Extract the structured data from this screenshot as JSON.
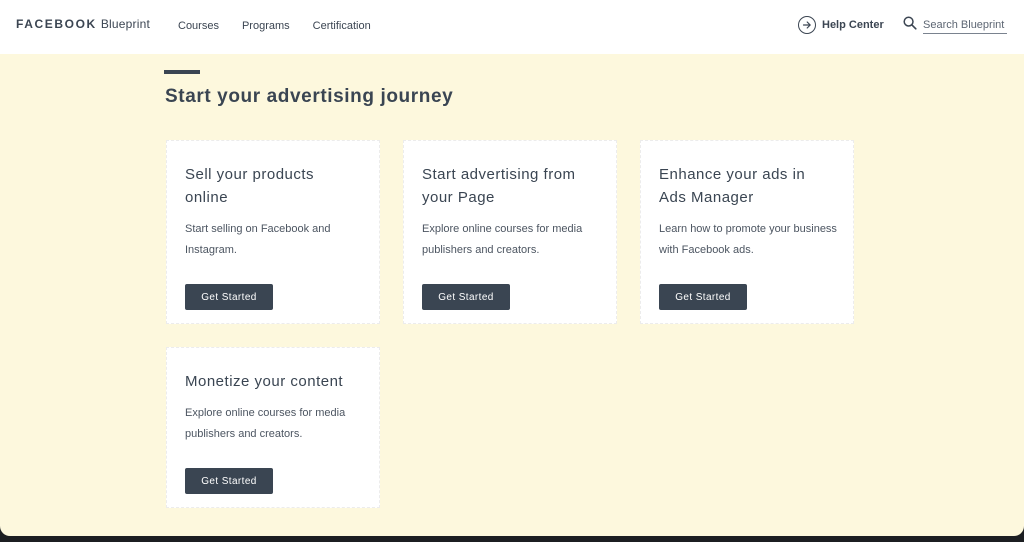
{
  "header": {
    "brand_facebook": "FACEBOOK",
    "brand_blueprint": "Blueprint",
    "nav": [
      {
        "label": "Courses"
      },
      {
        "label": "Programs"
      },
      {
        "label": "Certification"
      }
    ],
    "help_label": "Help Center",
    "search_placeholder": "Search Blueprint"
  },
  "main": {
    "heading": "Start your advertising journey",
    "cards": [
      {
        "title": "Sell your products online",
        "description": "Start selling on Facebook and Instagram.",
        "button": "Get Started"
      },
      {
        "title": "Start advertising from your Page",
        "description": "Explore online courses for media publishers and creators.",
        "button": "Get Started"
      },
      {
        "title": "Enhance your ads in Ads Manager",
        "description": "Learn how to promote your business with Facebook ads.",
        "button": "Get Started"
      },
      {
        "title": "Monetize your content",
        "description": "Explore online courses for media publishers and creators.",
        "button": "Get Started"
      }
    ]
  },
  "colors": {
    "page_background": "#fdf8dd",
    "header_background": "#ffffff",
    "primary_dark": "#3a4552",
    "card_background": "#ffffff"
  },
  "icons": {
    "help": "arrow-right-circle-icon",
    "search": "magnifier-icon"
  }
}
